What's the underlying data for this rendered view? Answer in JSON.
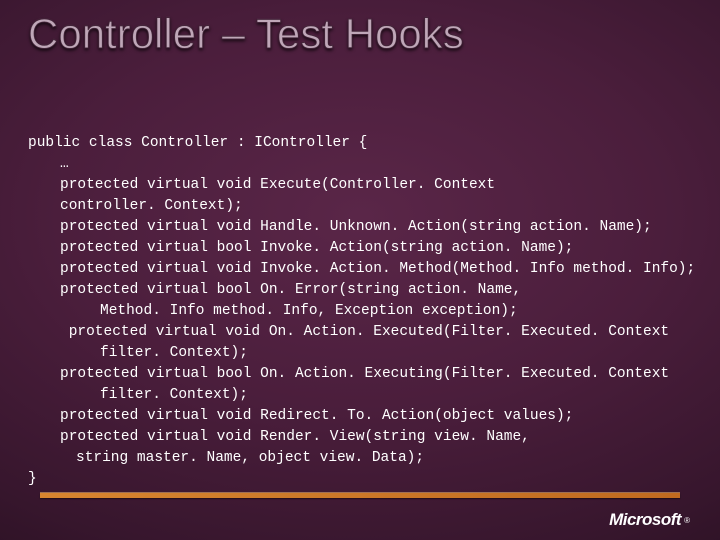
{
  "title": "Controller – Test Hooks",
  "code": {
    "l0": "public class Controller : IController {",
    "l1": "…",
    "l2": "protected virtual void Execute(Controller. Context",
    "l3": "controller. Context);",
    "l4": "protected virtual void Handle. Unknown. Action(string action. Name);",
    "l5": "protected virtual bool Invoke. Action(string action. Name);",
    "l6": "protected virtual void Invoke. Action. Method(Method. Info method. Info);",
    "l7": "protected virtual bool On. Error(string action. Name,",
    "l8": "Method. Info method. Info, Exception exception);",
    "l9": " protected virtual void On. Action. Executed(Filter. Executed. Context",
    "l10": "filter. Context);",
    "l11": "protected virtual bool On. Action. Executing(Filter. Executed. Context",
    "l12": "filter. Context);",
    "l13": "protected virtual void Redirect. To. Action(object values);",
    "l14": "protected virtual void Render. View(string view. Name,",
    "l15": "string master. Name, object view. Data);",
    "l16": "}"
  },
  "logo": "Microsoft",
  "logo_reg": "®"
}
